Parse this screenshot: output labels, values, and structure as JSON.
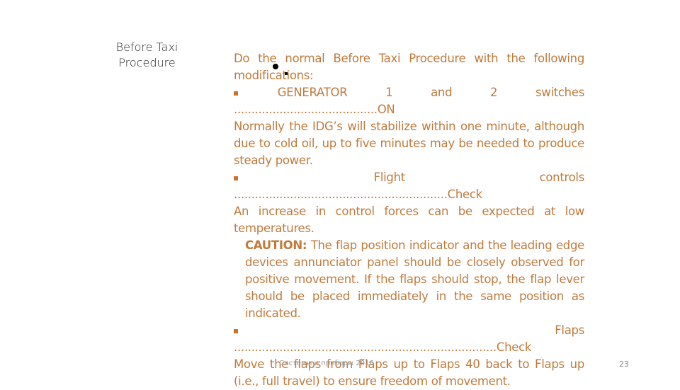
{
  "sidebar": {
    "title_line1": "Before Taxi",
    "title_line2": "Procedure"
  },
  "content": {
    "intro": "Do the normal Before Taxi Procedure with the following modifications:",
    "item1_label": "GENERATOR 1 and 2 switches",
    "item1_dots": ".........................................ON",
    "item1_note": "Normally the IDG’s will stabilize within one minute, although due to cold oil, up to five minutes may be needed to produce steady power.",
    "item2_label": "Flight controls",
    "item2_dots": ".............................................................Check",
    "item2_note": "An increase in control forces can be expected at low temperatures.",
    "caution_label": "CAUTION:",
    "caution_text": " The flap position indicator and the leading edge devices annunciator panel should be closely observed for positive movement. If the flaps should stop, the flap lever should be placed immediately in the same position as indicated.",
    "item3_label": "Flaps",
    "item3_dots": "...........................................................................Check",
    "item3_note": "Move the flaps from Flaps up to Flaps 40 back to Flaps up (i.e., full travel) to ensure freedom of movement."
  },
  "footer": {
    "text": "Системы и приборы 2016",
    "page_number": "23"
  },
  "colors": {
    "body_text": "#c07a3c",
    "title_text": "#222222"
  }
}
